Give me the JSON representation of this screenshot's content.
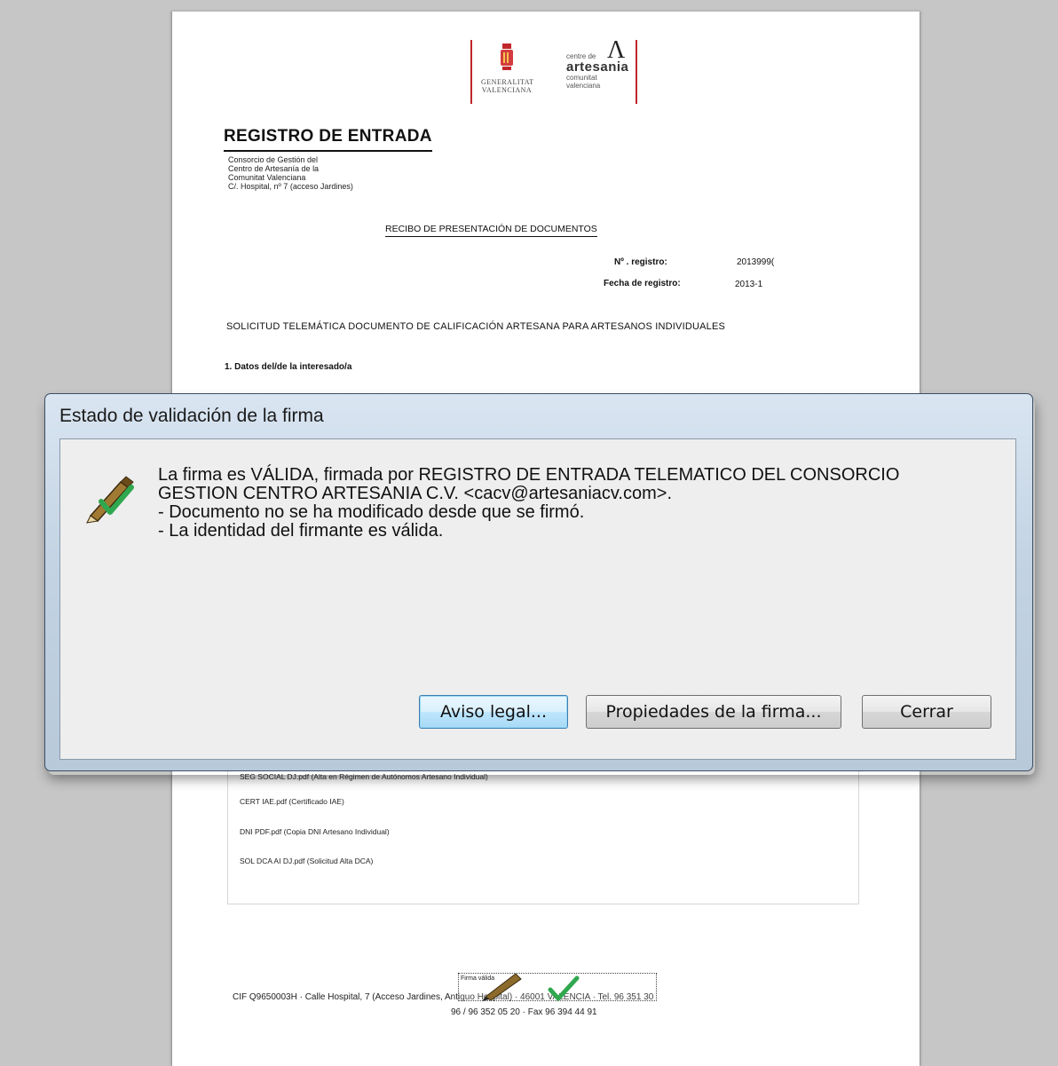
{
  "document": {
    "logos": {
      "generalitat_line1": "GENERALITAT",
      "generalitat_line2": "VALENCIANA",
      "centro_small": "centre de",
      "centro_big": "artesania",
      "centro_sub1": "comunitat",
      "centro_sub2": "valenciana"
    },
    "registro_title": "REGISTRO DE ENTRADA",
    "org_lines": [
      "Consorcio de Gestión del",
      "Centro de Artesanía de la",
      "Comunitat Valenciana",
      "C/. Hospital, nº 7 (acceso Jardines)"
    ],
    "recibo_title": "RECIBO DE PRESENTACIÓN DE DOCUMENTOS",
    "registro_num_label": "Nº . registro:",
    "registro_num_value": "2013999(",
    "fecha_label": "Fecha de registro:",
    "fecha_value": "2013-1",
    "solicitud": "SOLICITUD TELEMÁTICA DOCUMENTO DE CALIFICACIÓN ARTESANA PARA ARTESANOS INDIVIDUALES",
    "section_1": "1. Datos del/de la interesado/a",
    "docs": [
      "SEG SOCIAL DJ.pdf (Alta en Régimen de Autónomos Artesano Individual)",
      "CERT IAE.pdf (Certificado IAE)",
      "DNI PDF.pdf (Copia DNI Artesano Individual)",
      "SOL DCA AI DJ.pdf (Solicitud Alta DCA)"
    ],
    "signature_stamp_label": "Firma válida",
    "footer_line1": "CIF Q9650003H · Calle Hospital, 7 (Acceso Jardines, Antiguo Hospital) · 46001 VALENCIA · Tel. 96 351 30",
    "footer_line2": "96 / 96 352 05 20 · Fax 96 394 44 91"
  },
  "dialog": {
    "title": "Estado de validación de la firma",
    "icon": "valid-signature-icon",
    "message_lines": [
      "La firma es VÁLIDA, firmada por REGISTRO DE ENTRADA TELEMATICO DEL CONSORCIO",
      "GESTION CENTRO ARTESANIA C.V. <cacv@artesaniacv.com>.",
      "- Documento no se ha modificado desde que se firmó.",
      "- La identidad del firmante es válida."
    ],
    "buttons": {
      "legal": "Aviso legal...",
      "properties": "Propiedades de la firma...",
      "close": "Cerrar"
    }
  },
  "colors": {
    "accent_red": "#c0262b",
    "check_green": "#2fa84f",
    "dialog_frame": "#c3d3e3"
  }
}
